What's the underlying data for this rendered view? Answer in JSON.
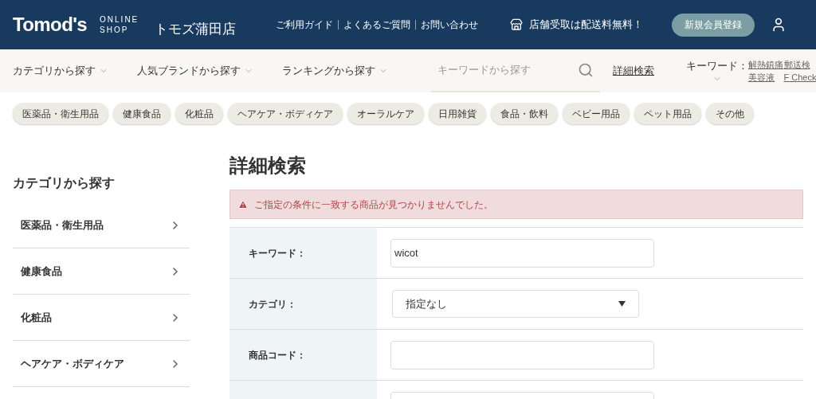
{
  "header": {
    "logo": "Tomod's",
    "logo_sub_1": "ONLINE",
    "logo_sub_2": "SHOP",
    "store": "トモズ蒲田店",
    "links": [
      "ご利用ガイド",
      "よくあるご質問",
      "お問い合わせ"
    ],
    "promo": "店舗受取は配送料無料！",
    "register_button": "新規会員登録"
  },
  "nav": {
    "menus": [
      "カテゴリから探す",
      "人気ブランドから探す",
      "ランキングから探す"
    ],
    "search": {
      "placeholder": "キーワードから探す"
    },
    "advanced_link": "詳細検索",
    "keyword_label": "キーワード：",
    "keywords": [
      "解熱鎮痛",
      "郵送検",
      "美容液",
      "F Check"
    ]
  },
  "chips": [
    "医薬品・衛生用品",
    "健康食品",
    "化粧品",
    "ヘアケア・ボディケア",
    "オーラルケア",
    "日用雑貨",
    "食品・飲料",
    "ベビー用品",
    "ペット用品",
    "その他"
  ],
  "sidebar": {
    "title": "カテゴリから探す",
    "items": [
      "医薬品・衛生用品",
      "健康食品",
      "化粧品",
      "ヘアケア・ボディケア"
    ]
  },
  "main": {
    "title": "詳細検索",
    "alert": "ご指定の条件に一致する商品が見つかりませんでした。",
    "rows": [
      {
        "kind": "text",
        "label": "キーワード：",
        "value": "wicot"
      },
      {
        "kind": "select",
        "label": "カテゴリ：",
        "value": "指定なし"
      },
      {
        "kind": "text",
        "label": "商品コード："
      },
      {
        "kind": "text"
      }
    ]
  }
}
